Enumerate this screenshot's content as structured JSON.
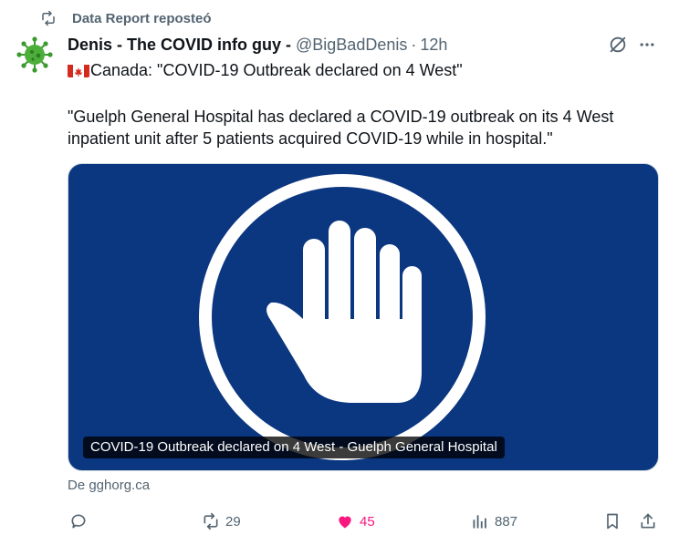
{
  "repost": {
    "text": "Data Report reposteó",
    "icon": "repost-icon"
  },
  "post": {
    "author_name": "Denis - The COVID info guy -",
    "handle": "@BigBadDenis",
    "separator": "·",
    "time": "12h",
    "flag": "flag-canada-icon",
    "headline": "Canada: \"COVID-19 Outbreak declared on 4 West\"",
    "body_line1": "\"Guelph General Hospital has declared a COVID-19 outbreak on its 4 West",
    "body_line2": "inpatient unit after 5 patients acquired COVID-19 while in hospital.\""
  },
  "card": {
    "caption": "COVID-19 Outbreak declared on 4 West - Guelph General Hospital",
    "source": "De gghorg.ca",
    "background_color": "#0b3680"
  },
  "actions": {
    "replies": "",
    "reposts": "29",
    "likes": "45",
    "views": "887",
    "like_color": "#f91880"
  }
}
